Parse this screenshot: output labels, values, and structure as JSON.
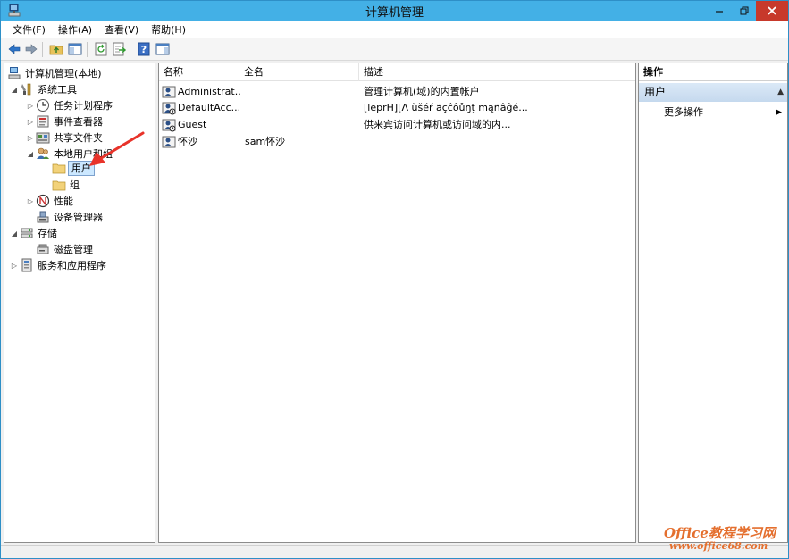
{
  "window": {
    "title": "计算机管理"
  },
  "menu": [
    {
      "label": "文件(F)"
    },
    {
      "label": "操作(A)"
    },
    {
      "label": "查看(V)"
    },
    {
      "label": "帮助(H)"
    }
  ],
  "toolbar": {
    "icons": [
      "back-arrow-icon",
      "forward-arrow-icon",
      "up-folder-icon",
      "show-hide-tree-icon",
      "refresh-icon",
      "export-list-icon",
      "help-icon",
      "show-hide-action-pane-icon"
    ]
  },
  "tree": {
    "root": "计算机管理(本地)",
    "system_tools": "系统工具",
    "task_scheduler": "任务计划程序",
    "event_viewer": "事件查看器",
    "shared_folders": "共享文件夹",
    "local_users": "本地用户和组",
    "users": "用户",
    "groups": "组",
    "performance": "性能",
    "device_manager": "设备管理器",
    "storage": "存储",
    "disk_management": "磁盘管理",
    "services_apps": "服务和应用程序"
  },
  "list": {
    "columns": {
      "name": "名称",
      "fullname": "全名",
      "description": "描述"
    },
    "rows": [
      {
        "name": "Administrat...",
        "fullname": "",
        "description": "管理计算机(域)的内置帐户"
      },
      {
        "name": "DefaultAcc...",
        "fullname": "",
        "description": "[leprH][Λ ùšéŕ ãçĉôůŋţ mąñâĝé..."
      },
      {
        "name": "Guest",
        "fullname": "",
        "description": "供来宾访问计算机或访问域的内..."
      },
      {
        "name": "怀沙",
        "fullname": "sam怀沙",
        "description": ""
      }
    ]
  },
  "actions": {
    "header": "操作",
    "section": "用户",
    "more": "更多操作"
  },
  "watermark": {
    "brand": "Office教程学习网",
    "url": "www.office68.com"
  },
  "colors": {
    "titlebar": "#43b0e6",
    "close": "#c7392b",
    "selection": "#cce8ff",
    "annotation": "#e8332a",
    "watermark": "#e46f2e"
  }
}
